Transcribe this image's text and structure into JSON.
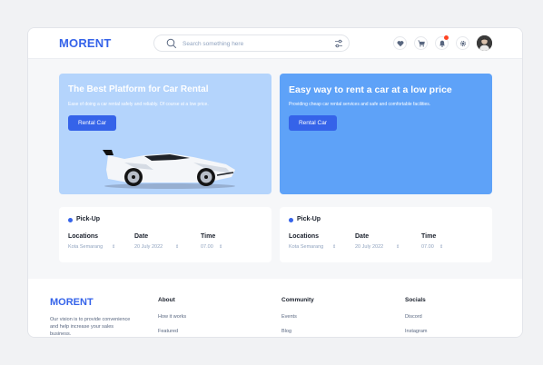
{
  "app": {
    "logo": "MORENT"
  },
  "header": {
    "search_placeholder": "Search something here",
    "icons": [
      "heart-icon",
      "cart-icon",
      "bell-icon",
      "gear-icon",
      "filter-icon"
    ]
  },
  "ads": [
    {
      "title": "The Best Platform for Car Rental",
      "desc": "Ease of doing a car rental safely and reliably. Of course at a low price.",
      "button": "Rental Car"
    },
    {
      "title": "Easy way to rent a car at a low price",
      "desc": "Providing cheap car rental services and safe and comfortable facilities.",
      "button": "Rental Car"
    }
  ],
  "pickups": [
    {
      "title": "Pick-Up",
      "loc_label": "Locations",
      "loc_value": "Kota Semarang",
      "date_label": "Date",
      "date_value": "20 July 2022",
      "time_label": "Time",
      "time_value": "07.00"
    },
    {
      "title": "Pick-Up",
      "loc_label": "Locations",
      "loc_value": "Kota Semarang",
      "date_label": "Date",
      "date_value": "20 July 2022",
      "time_label": "Time",
      "time_value": "07.00"
    }
  ],
  "footer": {
    "logo": "MORENT",
    "desc": "Our vision is to provide convenience and help increase your sales business.",
    "about": {
      "title": "About",
      "links": [
        "How it works",
        "Featured"
      ]
    },
    "community": {
      "title": "Community",
      "links": [
        "Events",
        "Blog"
      ]
    },
    "socials": {
      "title": "Socials",
      "links": [
        "Discord",
        "Instagram"
      ]
    }
  },
  "colors": {
    "brand": "#3563e9",
    "ad1_bg": "#b4d4fc",
    "ad2_bg": "#5ea2f8",
    "notification": "#ff4423"
  }
}
